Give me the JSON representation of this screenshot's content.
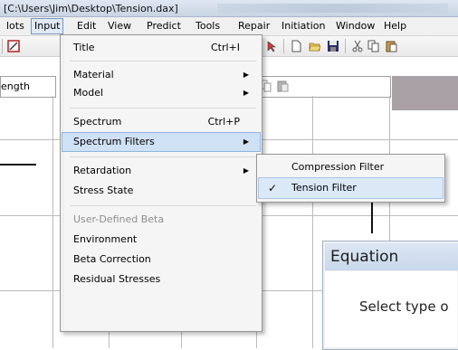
{
  "window": {
    "title": "[C:\\Users\\Jim\\Desktop\\Tension.dax]"
  },
  "menubar": {
    "items": [
      "lots",
      "Input",
      "Edit",
      "View",
      "Predict",
      "Tools",
      "Repair",
      "Initiation",
      "Window",
      "Help"
    ]
  },
  "panel": {
    "label": "ength"
  },
  "input_menu": {
    "items": [
      {
        "label": "Title",
        "shortcut": "Ctrl+I"
      },
      {
        "label": "Material"
      },
      {
        "label": "Model"
      },
      {
        "label": "Spectrum",
        "shortcut": "Ctrl+P"
      },
      {
        "label": "Spectrum Filters"
      },
      {
        "label": "Retardation"
      },
      {
        "label": "Stress State"
      },
      {
        "label": "User-Defined Beta"
      },
      {
        "label": "Environment"
      },
      {
        "label": "Beta Correction"
      },
      {
        "label": "Residual Stresses"
      }
    ]
  },
  "spectrum_filters_submenu": {
    "items": [
      {
        "label": "Compression Filter",
        "checked": false
      },
      {
        "label": "Tension Filter",
        "checked": true
      }
    ]
  },
  "dialog": {
    "title": "Equation",
    "prompt": "Select type o"
  },
  "glyphs": {
    "submenu_arrow": "▶",
    "check": "✓"
  }
}
